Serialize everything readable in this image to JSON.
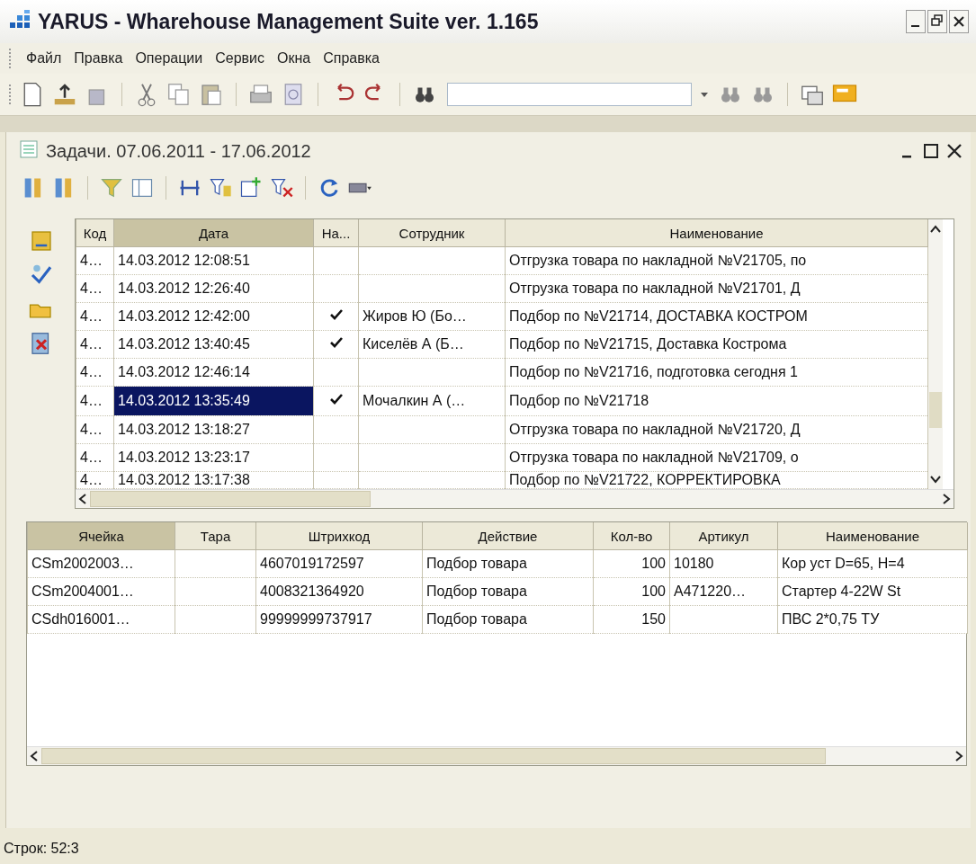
{
  "window": {
    "title": "YARUS - Wharehouse Management Suite ver. 1.165"
  },
  "menu": [
    "Файл",
    "Правка",
    "Операции",
    "Сервис",
    "Окна",
    "Справка"
  ],
  "document": {
    "title": "Задачи. 07.06.2011 - 17.06.2012"
  },
  "tasks": {
    "columns": [
      {
        "label": "Код",
        "sorted": false
      },
      {
        "label": "Дата",
        "sorted": true
      },
      {
        "label": "На...",
        "sorted": false
      },
      {
        "label": "Сотрудник",
        "sorted": false
      },
      {
        "label": "Наименование",
        "sorted": false
      }
    ],
    "rows": [
      {
        "code": "4…",
        "date": "14.03.2012 12:08:51",
        "done": false,
        "employee": "",
        "name": "Отгрузка товара по накладной №V21705, по",
        "selected": false
      },
      {
        "code": "4…",
        "date": "14.03.2012 12:26:40",
        "done": false,
        "employee": "",
        "name": "Отгрузка товара по накладной №V21701, Д",
        "selected": false
      },
      {
        "code": "4…",
        "date": "14.03.2012 12:42:00",
        "done": true,
        "employee": "Жиров Ю (Бо…",
        "name": "Подбор по №V21714, ДОСТАВКА КОСТРОМ",
        "selected": false
      },
      {
        "code": "4…",
        "date": "14.03.2012 13:40:45",
        "done": true,
        "employee": "Киселёв А (Б…",
        "name": "Подбор по №V21715, Доставка Кострома",
        "selected": false
      },
      {
        "code": "4…",
        "date": "14.03.2012 12:46:14",
        "done": false,
        "employee": "",
        "name": "Подбор по №V21716, подготовка сегодня 1",
        "selected": false
      },
      {
        "code": "4…",
        "date": "14.03.2012 13:35:49",
        "done": true,
        "employee": "Мочалкин А (…",
        "name": "Подбор по №V21718",
        "selected": true
      },
      {
        "code": "4…",
        "date": "14.03.2012 13:18:27",
        "done": false,
        "employee": "",
        "name": "Отгрузка товара по накладной №V21720, Д",
        "selected": false
      },
      {
        "code": "4…",
        "date": "14.03.2012 13:23:17",
        "done": false,
        "employee": "",
        "name": "Отгрузка товара по накладной №V21709, о",
        "selected": false
      },
      {
        "code": "4…",
        "date": "14.03.2012 13:17:38",
        "done": false,
        "employee": "",
        "name": "Подбор по №V21722, КОРРЕКТИРОВКА",
        "selected": false
      }
    ]
  },
  "items": {
    "columns": [
      {
        "label": "Ячейка",
        "sorted": true,
        "kind": "text"
      },
      {
        "label": "Тара",
        "sorted": false,
        "kind": "text"
      },
      {
        "label": "Штрихкод",
        "sorted": false,
        "kind": "text"
      },
      {
        "label": "Действие",
        "sorted": false,
        "kind": "text"
      },
      {
        "label": "Кол-во",
        "sorted": false,
        "kind": "number"
      },
      {
        "label": "Артикул",
        "sorted": false,
        "kind": "text"
      },
      {
        "label": "Наименование",
        "sorted": false,
        "kind": "text"
      }
    ],
    "rows": [
      [
        "CSm2002003…",
        "",
        "4607019172597",
        "Подбор товара",
        "100",
        "10180",
        "Кор уст D=65, H=4"
      ],
      [
        "CSm2004001…",
        "",
        "4008321364920",
        "Подбор товара",
        "100",
        "A471220…",
        "Стартер 4-22W St"
      ],
      [
        "CSdh016001…",
        "",
        "99999999737917",
        "Подбор товара",
        "150",
        "",
        "ПВС 2*0,75 ТУ"
      ]
    ]
  },
  "status_bar": "Строк: 52:3"
}
